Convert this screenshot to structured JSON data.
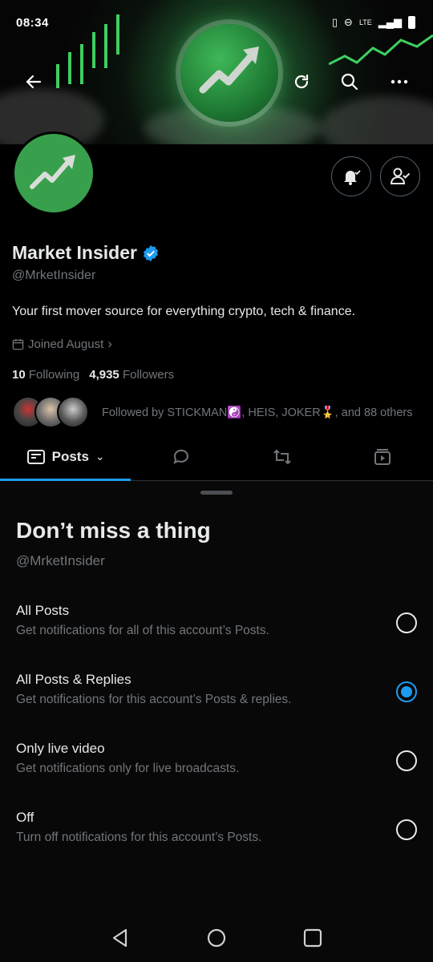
{
  "status_bar": {
    "time": "08:34",
    "network": "LTE"
  },
  "banner": {
    "back_icon": "arrow-left-icon",
    "refresh_icon": "refresh-icon",
    "search_icon": "search-icon",
    "more_icon": "more-icon"
  },
  "profile": {
    "name": "Market Insider",
    "handle": "@MrketInsider",
    "bio": "Your first mover source for everything crypto, tech & finance.",
    "joined": "Joined August",
    "following_count": "10",
    "following_label": "Following",
    "followers_count": "4,935",
    "followers_label": "Followers",
    "followed_by": "Followed by STICKMAN☯️, HEIS, JOKER🎖️, and 88 others"
  },
  "tabs": {
    "posts_label": "Posts"
  },
  "sheet": {
    "title": "Don’t miss a thing",
    "handle": "@MrketInsider",
    "options": [
      {
        "title": "All Posts",
        "subtitle": "Get notifications for all of this account’s Posts.",
        "selected": false
      },
      {
        "title": "All Posts & Replies",
        "subtitle": "Get notifications for this account’s Posts & replies.",
        "selected": true
      },
      {
        "title": "Only live video",
        "subtitle": "Get notifications only for live broadcasts.",
        "selected": false
      },
      {
        "title": "Off",
        "subtitle": "Turn off notifications for this account’s Posts.",
        "selected": false
      }
    ]
  },
  "colors": {
    "accent": "#1d9bf0",
    "brand_green": "#38a04c",
    "muted": "#71767b"
  }
}
